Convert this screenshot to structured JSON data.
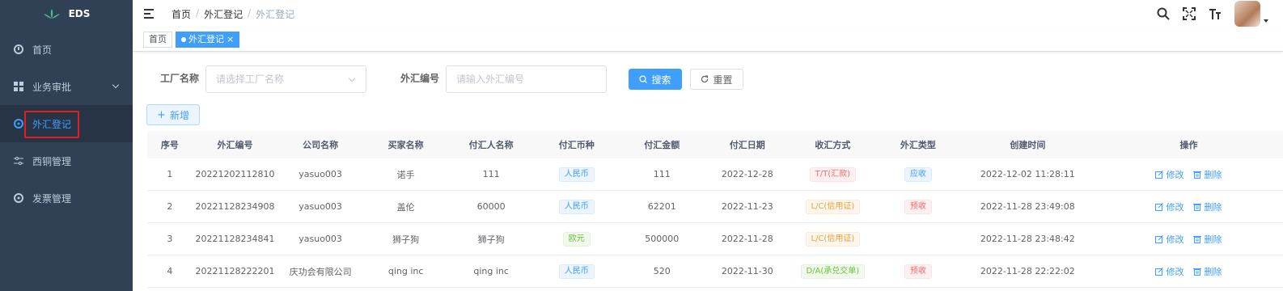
{
  "app": {
    "logo_text": "EDS"
  },
  "sidebar": {
    "items": [
      {
        "label": "首页",
        "icon": "dashboard-icon"
      },
      {
        "label": "业务审批",
        "icon": "grid-icon"
      },
      {
        "label": "外汇登记",
        "icon": "circle-icon"
      },
      {
        "label": "西铜管理",
        "icon": "sliders-icon"
      },
      {
        "label": "发票管理",
        "icon": "circle-icon"
      }
    ]
  },
  "breadcrumb": {
    "home": "首页",
    "parent": "外汇登记",
    "current": "外汇登记",
    "sep": "/"
  },
  "tags": {
    "home": "首页",
    "active": "外汇登记",
    "close": "×"
  },
  "filters": {
    "factory_label": "工厂名称",
    "factory_placeholder": "请选择工厂名称",
    "fx_label": "外汇编号",
    "fx_placeholder": "请输入外汇编号",
    "search_btn": "搜索",
    "reset_btn": "重置",
    "add_btn": "新增"
  },
  "table": {
    "columns": [
      "序号",
      "外汇编号",
      "公司名称",
      "买家名称",
      "付汇人名称",
      "付汇币种",
      "付汇金额",
      "付汇日期",
      "收汇方式",
      "外汇类型",
      "创建时间",
      "操作"
    ],
    "rows": [
      {
        "idx": "1",
        "fx_no": "20221202112810",
        "company": "yasuo003",
        "buyer": "诺手",
        "payer": "111",
        "currency": "人民币",
        "currency_color": "blue",
        "amount": "111",
        "date": "2022-12-28",
        "method": "T/T(汇款)",
        "method_color": "red",
        "type": "应收",
        "type_color": "blue",
        "created": "2022-12-02 11:28:11"
      },
      {
        "idx": "2",
        "fx_no": "20221128234908",
        "company": "yasuo003",
        "buyer": "盖伦",
        "payer": "60000",
        "currency": "人民币",
        "currency_color": "blue",
        "amount": "62201",
        "date": "2022-11-23",
        "method": "L/C(信用证)",
        "method_color": "orange",
        "type": "预收",
        "type_color": "red",
        "created": "2022-11-28 23:49:08"
      },
      {
        "idx": "3",
        "fx_no": "20221128234841",
        "company": "yasuo003",
        "buyer": "狮子狗",
        "payer": "狮子狗",
        "currency": "欧元",
        "currency_color": "green",
        "amount": "500000",
        "date": "2022-11-28",
        "method": "L/C(信用证)",
        "method_color": "orange",
        "type": "",
        "type_color": "",
        "created": "2022-11-28 23:48:42"
      },
      {
        "idx": "4",
        "fx_no": "20221128222201",
        "company": "庆功会有限公司",
        "buyer": "qing inc",
        "payer": "qing inc",
        "currency": "人民币",
        "currency_color": "blue",
        "amount": "520",
        "date": "2022-11-30",
        "method": "D/A(承兑交单)",
        "method_color": "green",
        "type": "预收",
        "type_color": "red",
        "created": "2022-11-28 22:22:02"
      }
    ],
    "edit_label": "修改",
    "delete_label": "删除"
  }
}
